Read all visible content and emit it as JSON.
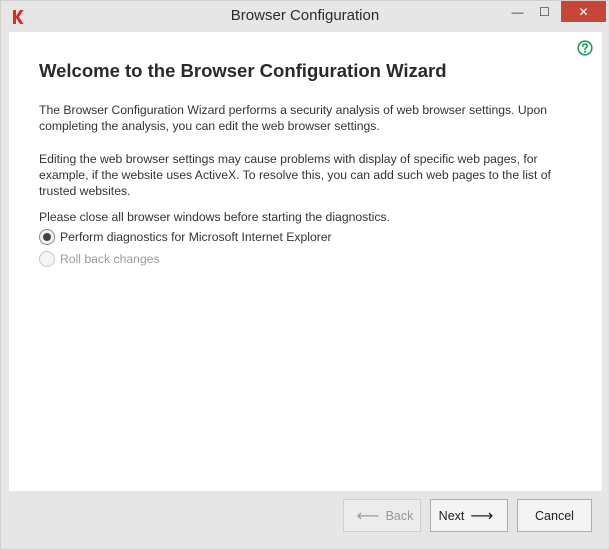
{
  "window": {
    "title": "Browser Configuration",
    "minimize_glyph": "—",
    "maximize_glyph": "☐",
    "close_glyph": "✕"
  },
  "icons": {
    "app": "kaspersky-logo-icon",
    "help": "help-circle-icon"
  },
  "colors": {
    "accent_green": "#1f9e5b",
    "close_red": "#c7463a",
    "logo_red": "#d32f2f"
  },
  "content": {
    "heading": "Welcome to the Browser Configuration Wizard",
    "paragraph1": "The Browser Configuration Wizard performs a security analysis of web browser settings. Upon completing the analysis, you can edit the web browser settings.",
    "paragraph2": "Editing the web browser settings may cause problems with display of specific web pages, for example, if the website uses ActiveX. To resolve this, you can add such web pages to the list of trusted websites.",
    "paragraph3": "Please close all browser windows before starting the diagnostics.",
    "options": [
      {
        "label": "Perform diagnostics for Microsoft Internet Explorer",
        "selected": true,
        "enabled": true
      },
      {
        "label": "Roll back changes",
        "selected": false,
        "enabled": false
      }
    ]
  },
  "footer": {
    "back_label": "Back",
    "next_label": "Next",
    "cancel_label": "Cancel",
    "back_arrow": "⟵",
    "next_arrow": "⟶"
  }
}
